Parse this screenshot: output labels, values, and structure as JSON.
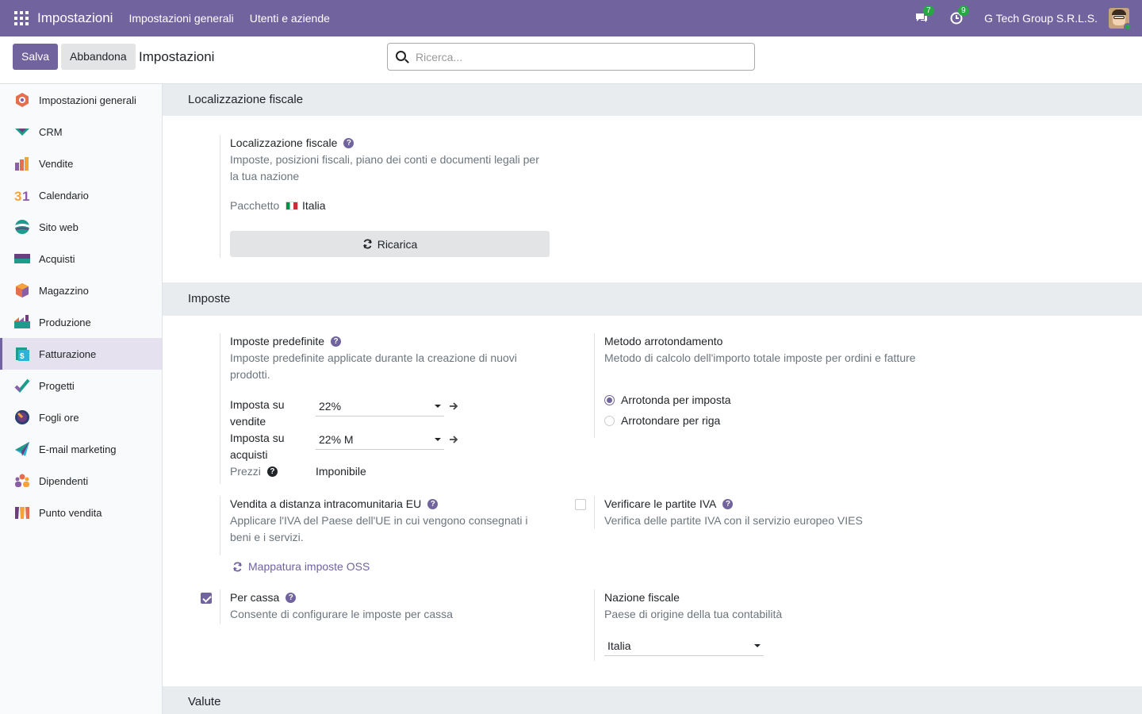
{
  "topbar": {
    "app_title": "Impostazioni",
    "menu": [
      "Impostazioni generali",
      "Utenti e aziende"
    ],
    "messages_count": "7",
    "activities_count": "9",
    "company": "G Tech Group S.R.L.S."
  },
  "control": {
    "save_label": "Salva",
    "discard_label": "Abbandona",
    "title": "Impostazioni",
    "search_placeholder": "Ricerca..."
  },
  "sidebar": {
    "items": [
      {
        "label": "Impostazioni generali",
        "icon": "settings-app-icon"
      },
      {
        "label": "CRM",
        "icon": "crm-app-icon"
      },
      {
        "label": "Vendite",
        "icon": "sales-app-icon"
      },
      {
        "label": "Calendario",
        "icon": "calendar-app-icon"
      },
      {
        "label": "Sito web",
        "icon": "website-app-icon"
      },
      {
        "label": "Acquisti",
        "icon": "purchase-app-icon"
      },
      {
        "label": "Magazzino",
        "icon": "inventory-app-icon"
      },
      {
        "label": "Produzione",
        "icon": "manufacturing-app-icon"
      },
      {
        "label": "Fatturazione",
        "icon": "invoicing-app-icon",
        "active": true
      },
      {
        "label": "Progetti",
        "icon": "project-app-icon"
      },
      {
        "label": "Fogli ore",
        "icon": "timesheets-app-icon"
      },
      {
        "label": "E-mail marketing",
        "icon": "email-marketing-app-icon"
      },
      {
        "label": "Dipendenti",
        "icon": "employees-app-icon"
      },
      {
        "label": "Punto vendita",
        "icon": "pos-app-icon"
      }
    ]
  },
  "fiscal": {
    "section_title": "Localizzazione fiscale",
    "title": "Localizzazione fiscale",
    "desc_line1": "Imposte, posizioni fiscali, piano dei conti e documenti legali per",
    "desc_line2": "la tua nazione",
    "package_label": "Pacchetto",
    "package_value": "Italia",
    "reload_label": "Ricarica"
  },
  "taxes": {
    "section_title": "Imposte",
    "default_title": "Imposte predefinite",
    "default_desc_line1": "Imposte predefinite applicate durante la creazione di nuovi",
    "default_desc_line2": "prodotti.",
    "sales_tax_label_1": "Imposta su",
    "sales_tax_label_2": "vendite",
    "sales_tax_value": "22%",
    "purchase_tax_label_1": "Imposta su",
    "purchase_tax_label_2": "acquisti",
    "purchase_tax_value": "22% M",
    "prices_label": "Prezzi",
    "prices_value": "Imponibile",
    "rounding_title": "Metodo arrotondamento",
    "rounding_desc": "Metodo di calcolo dell'importo totale imposte per ordini e fatture",
    "rounding_options": [
      "Arrotonda per imposta",
      "Arrotondare per riga"
    ],
    "eu_title": "Vendita a distanza intracomunitaria EU",
    "eu_desc_line1": "Applicare l'IVA del Paese dell'UE in cui vengono consegnati i",
    "eu_desc_line2": "beni e i servizi.",
    "oss_link": "Mappatura imposte OSS",
    "vies_title": "Verificare le partite IVA",
    "vies_desc": "Verifica delle partite IVA con il servizio europeo VIES",
    "cash_title": "Per cassa",
    "cash_desc": "Consente di configurare le imposte per cassa",
    "country_title": "Nazione fiscale",
    "country_desc": "Paese di origine della tua contabilità",
    "country_value": "Italia"
  },
  "currencies": {
    "section_title": "Valute"
  },
  "colors": {
    "brand": "#71639e",
    "badge": "#28a745",
    "section_bg": "#e9ecef"
  }
}
